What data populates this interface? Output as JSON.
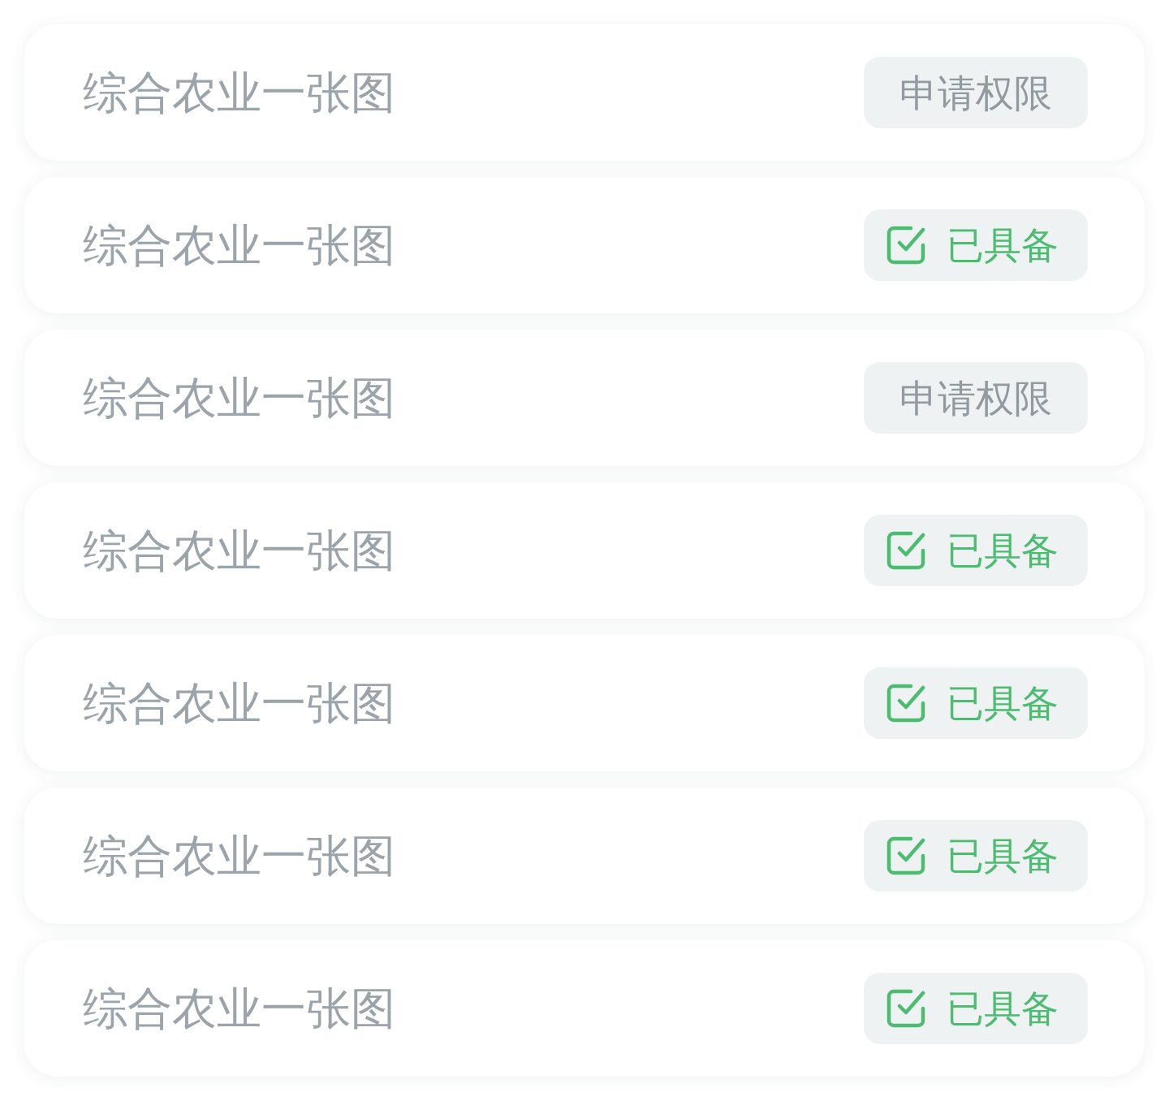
{
  "items": [
    {
      "title": "综合农业一张图",
      "badge": {
        "kind": "request",
        "label": "申请权限"
      }
    },
    {
      "title": "综合农业一张图",
      "badge": {
        "kind": "granted",
        "label": "已具备"
      }
    },
    {
      "title": "综合农业一张图",
      "badge": {
        "kind": "request",
        "label": "申请权限"
      }
    },
    {
      "title": "综合农业一张图",
      "badge": {
        "kind": "granted",
        "label": "已具备"
      }
    },
    {
      "title": "综合农业一张图",
      "badge": {
        "kind": "granted",
        "label": "已具备"
      }
    },
    {
      "title": "综合农业一张图",
      "badge": {
        "kind": "granted",
        "label": "已具备"
      }
    },
    {
      "title": "综合农业一张图",
      "badge": {
        "kind": "granted",
        "label": "已具备"
      }
    }
  ]
}
